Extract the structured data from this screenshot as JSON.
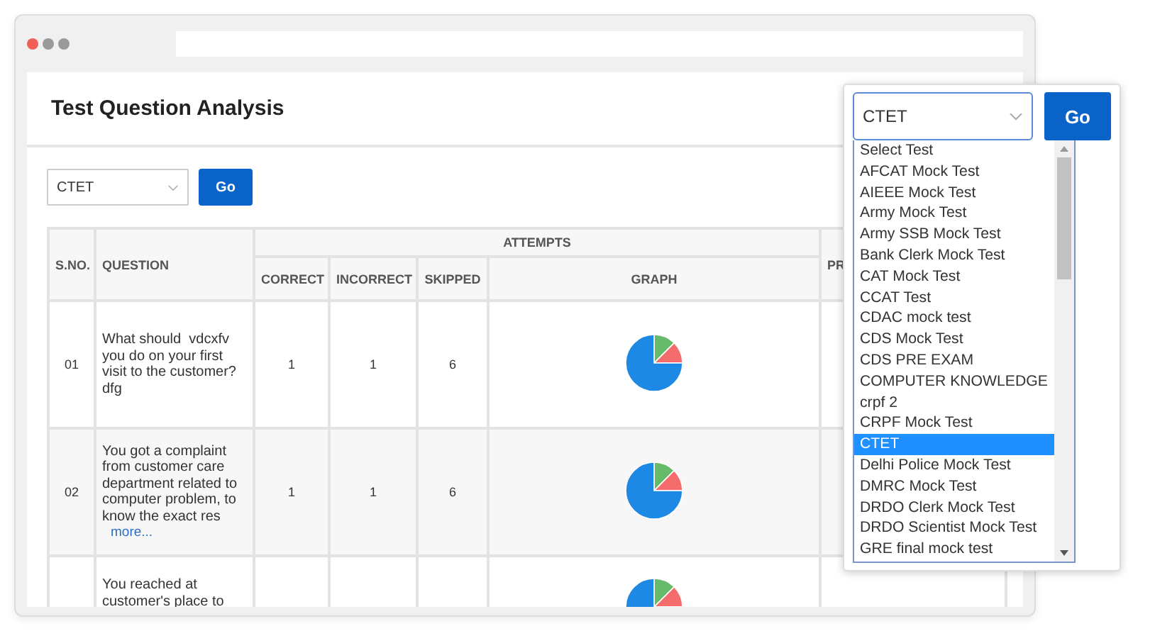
{
  "page": {
    "title": "Test Question Analysis"
  },
  "filter": {
    "value": "CTET",
    "button": "Go"
  },
  "table": {
    "group_header": "ATTEMPTS",
    "columns": [
      "S.NO.",
      "QUESTION",
      "CORRECT",
      "INCORRECT",
      "SKIPPED",
      "GRAPH",
      "PR"
    ],
    "rows": [
      {
        "sno": "01",
        "question": "What should  vdcxfv you do on your first visit to the customer?dfg",
        "correct": "1",
        "incorrect": "1",
        "skipped": "6"
      },
      {
        "sno": "02",
        "question": "You got a complaint from customer care department related to computer problem, to know the exact res",
        "more": "more...",
        "correct": "1",
        "incorrect": "1",
        "skipped": "6"
      },
      {
        "question": "You reached at customer's place to"
      }
    ]
  },
  "popup": {
    "value": "CTET",
    "button": "Go",
    "options": [
      {
        "label": "Select Test",
        "selected": false
      },
      {
        "label": "AFCAT Mock Test",
        "selected": false
      },
      {
        "label": "AIEEE Mock Test",
        "selected": false
      },
      {
        "label": "Army Mock Test",
        "selected": false
      },
      {
        "label": "Army SSB Mock Test",
        "selected": false
      },
      {
        "label": "Bank Clerk Mock Test",
        "selected": false
      },
      {
        "label": "CAT Mock Test",
        "selected": false
      },
      {
        "label": "CCAT Test",
        "selected": false
      },
      {
        "label": "CDAC mock test",
        "selected": false
      },
      {
        "label": "CDS Mock Test",
        "selected": false
      },
      {
        "label": "CDS PRE EXAM",
        "selected": false
      },
      {
        "label": "COMPUTER KNOWLEDGE",
        "selected": false
      },
      {
        "label": "crpf 2",
        "selected": false
      },
      {
        "label": "CRPF Mock Test",
        "selected": false
      },
      {
        "label": "CTET",
        "selected": true
      },
      {
        "label": "Delhi Police Mock Test",
        "selected": false
      },
      {
        "label": "DMRC Mock Test",
        "selected": false
      },
      {
        "label": "DRDO Clerk Mock Test",
        "selected": false
      },
      {
        "label": "DRDO Scientist Mock Test",
        "selected": false
      },
      {
        "label": "GRE final mock test",
        "selected": false
      }
    ]
  }
}
